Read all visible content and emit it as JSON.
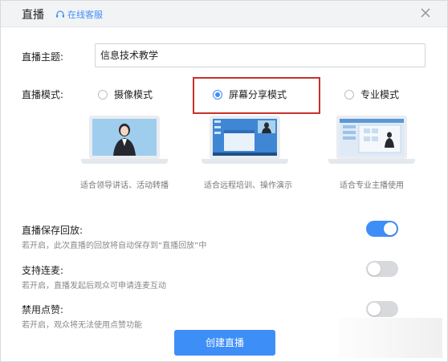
{
  "header": {
    "title": "直播",
    "customer_service": "在线客服",
    "close_icon": "close-icon",
    "headset_icon": "headset-icon"
  },
  "topic": {
    "label": "直播主题:",
    "value": "信息技术教学"
  },
  "mode": {
    "label": "直播模式:",
    "options": [
      {
        "label": "摄像模式",
        "selected": false,
        "caption": "适合领导讲话、活动转播"
      },
      {
        "label": "屏幕分享模式",
        "selected": true,
        "caption": "适合远程培训、操作演示"
      },
      {
        "label": "专业模式",
        "selected": false,
        "caption": "适合专业主播使用"
      }
    ]
  },
  "settings": [
    {
      "title": "直播保存回放:",
      "desc": "若开启，此次直播的回放将自动保存到“直播回放”中",
      "on": true
    },
    {
      "title": "支持连麦:",
      "desc": "若开启，直播发起后观众可申请连麦互动",
      "on": false
    },
    {
      "title": "禁用点赞:",
      "desc": "若开启，观众将无法使用点赞功能",
      "on": false
    }
  ],
  "create_button": "创建直播",
  "colors": {
    "accent": "#3e8ef7",
    "highlight_border": "#c8312d",
    "header_bg": "#f2f3f5"
  }
}
